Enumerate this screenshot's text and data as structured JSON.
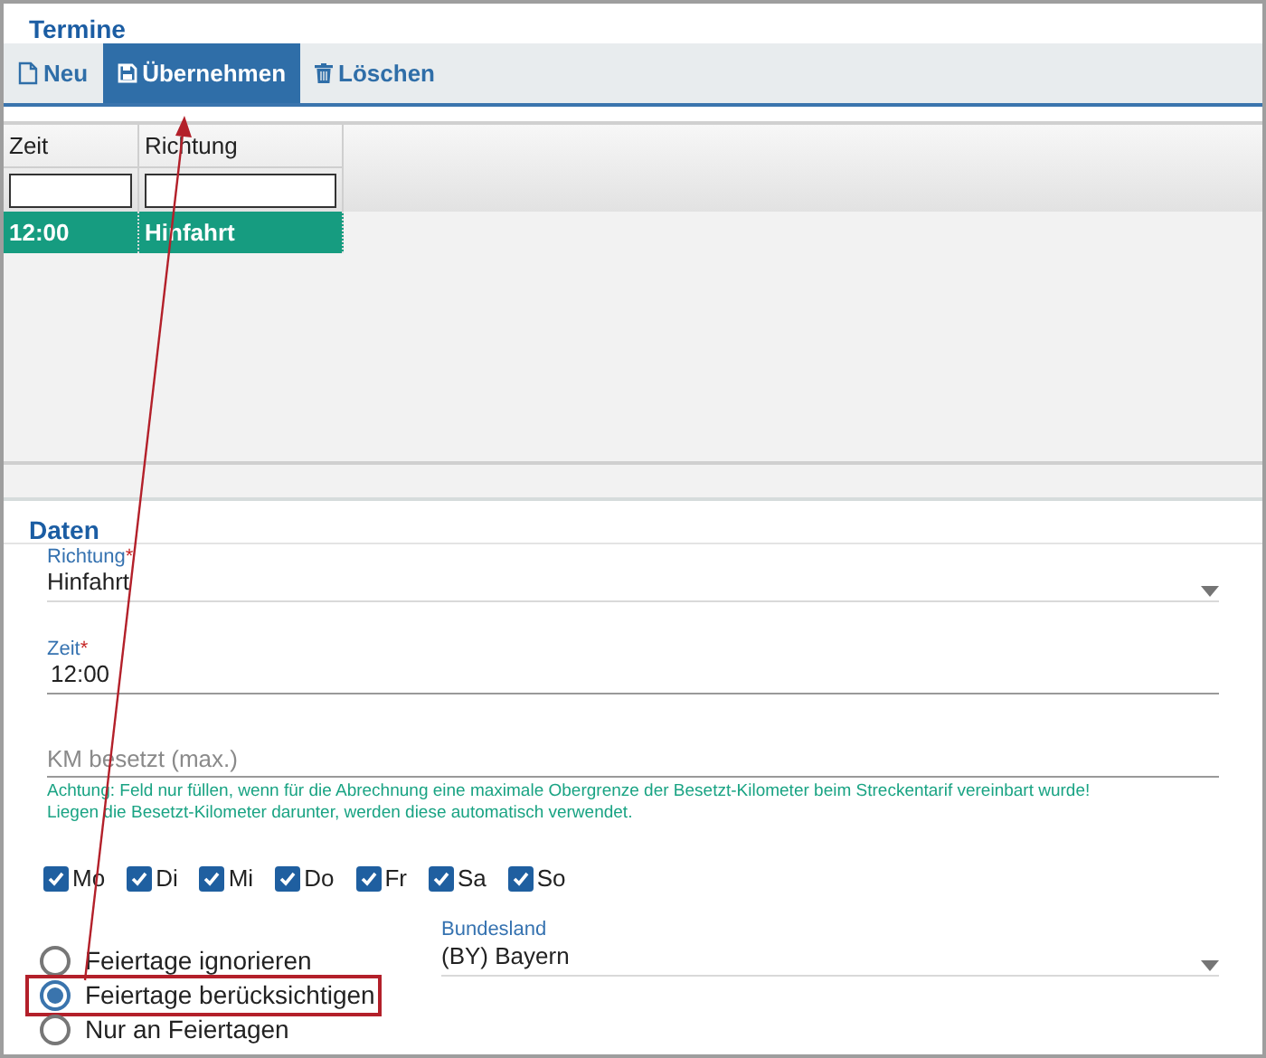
{
  "termine": {
    "title": "Termine",
    "toolbar": [
      {
        "label": "Neu",
        "kind": "new",
        "selected": false
      },
      {
        "label": "Übernehmen",
        "kind": "save",
        "selected": true
      },
      {
        "label": "Löschen",
        "kind": "delete",
        "selected": false
      }
    ],
    "table": {
      "columns": [
        "Zeit",
        "Richtung"
      ],
      "rows": [
        {
          "cells": [
            "12:00",
            "Hinfahrt"
          ],
          "selected": true
        }
      ]
    }
  },
  "daten": {
    "title": "Daten",
    "richtung": {
      "label": "Richtung",
      "required_mark": "*",
      "value": "Hinfahrt"
    },
    "zeit": {
      "label": "Zeit",
      "required_mark": "*",
      "value": "12:00"
    },
    "km": {
      "placeholder": "KM besetzt (max.)",
      "hint": [
        "Achtung: Feld nur füllen, wenn für die Abrechnung eine maximale Obergrenze der Besetzt-Kilometer beim Streckentarif vereinbart wurde!",
        "Liegen die Besetzt-Kilometer darunter, werden diese automatisch verwendet."
      ]
    },
    "days": [
      {
        "label": "Mo",
        "checked": true
      },
      {
        "label": "Di",
        "checked": true
      },
      {
        "label": "Mi",
        "checked": true
      },
      {
        "label": "Do",
        "checked": true
      },
      {
        "label": "Fr",
        "checked": true
      },
      {
        "label": "Sa",
        "checked": true
      },
      {
        "label": "So",
        "checked": true
      }
    ],
    "holidays": [
      {
        "label": "Feiertage ignorieren",
        "selected": false,
        "highlighted": false
      },
      {
        "label": "Feiertage berücksichtigen",
        "selected": true,
        "highlighted": true
      },
      {
        "label": "Nur an Feiertagen",
        "selected": false,
        "highlighted": false
      }
    ],
    "bundesland": {
      "label": "Bundesland",
      "value": "(BY) Bayern"
    }
  }
}
